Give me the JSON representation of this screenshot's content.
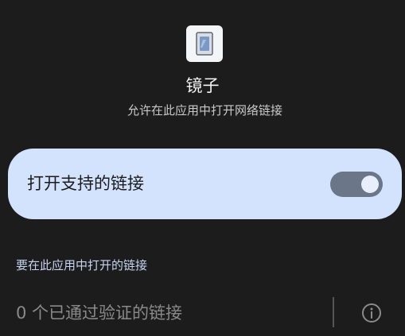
{
  "app": {
    "name": "镜子",
    "subtitle": "允许在此应用中打开网络链接",
    "icon": "mirror-app-icon"
  },
  "toggle": {
    "label": "打开支持的链接",
    "state": true
  },
  "links_section": {
    "header": "要在此应用中打开的链接",
    "verified_text": "0 个已通过验证的链接",
    "info_icon": "info-icon"
  },
  "colors": {
    "background": "#1c1c1c",
    "card": "#d3e3fd",
    "switch_track": "#6b7689",
    "section_header": "#c6d4f0"
  }
}
